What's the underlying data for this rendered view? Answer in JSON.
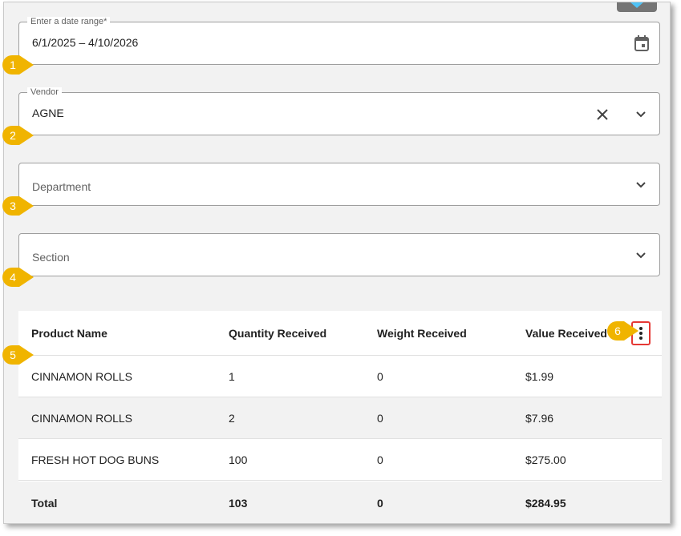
{
  "filters": {
    "date_range": {
      "label": "Enter a date range*",
      "value": "6/1/2025 – 4/10/2026",
      "icon": "calendar-icon"
    },
    "vendor": {
      "label": "Vendor",
      "value": "AGNE",
      "icon_clear": "close-icon",
      "icon_open": "chevron-down-icon"
    },
    "department": {
      "placeholder": "Department",
      "icon": "chevron-down-icon"
    },
    "section": {
      "placeholder": "Section",
      "icon": "chevron-down-icon"
    }
  },
  "table": {
    "columns": [
      "Product Name",
      "Quantity Received",
      "Weight Received",
      "Value Received"
    ],
    "rows": [
      [
        "CINNAMON ROLLS",
        "1",
        "0",
        "$1.99"
      ],
      [
        "CINNAMON ROLLS",
        "2",
        "0",
        "$7.96"
      ],
      [
        "FRESH HOT DOG BUNS",
        "100",
        "0",
        "$275.00"
      ]
    ],
    "total": [
      "Total",
      "103",
      "0",
      "$284.95"
    ],
    "menu_icon": "more-vertical-icon"
  },
  "callouts": [
    "1",
    "2",
    "3",
    "4",
    "5",
    "6"
  ],
  "colors": {
    "callout": "#f0b400",
    "highlight": "#e53935",
    "accent": "#4fc3f7"
  }
}
